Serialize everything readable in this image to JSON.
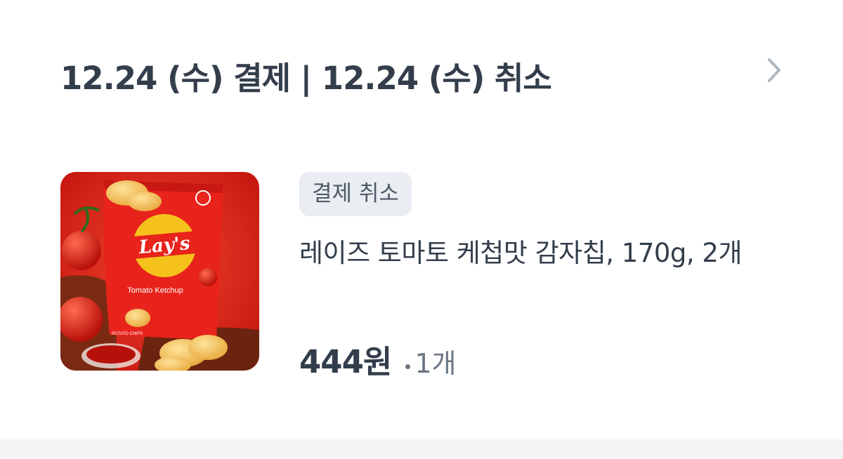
{
  "order": {
    "header_title": "12.24 (수) 결제 | 12.24 (수) 취소",
    "status_badge": "결제 취소",
    "product_name": "레이즈 토마토 케첩맛 감자칩, 170g, 2개",
    "price": "444원",
    "quantity": "1개"
  },
  "product_image": {
    "brand_logo_text": "Lay's",
    "flavor_text": "Tomato Ketchup",
    "package_subtext": "POTATO CHIPS"
  },
  "icons": {
    "detail": "chevron-right-icon"
  },
  "colors": {
    "title": "#333d4b",
    "badge_bg": "#eaedf1",
    "badge_text": "#4e5968",
    "secondary_text": "#6b7684",
    "chevron": "#b0b8c1",
    "page_bottom": "#f2f4f6",
    "product_red": "#e8231b"
  }
}
